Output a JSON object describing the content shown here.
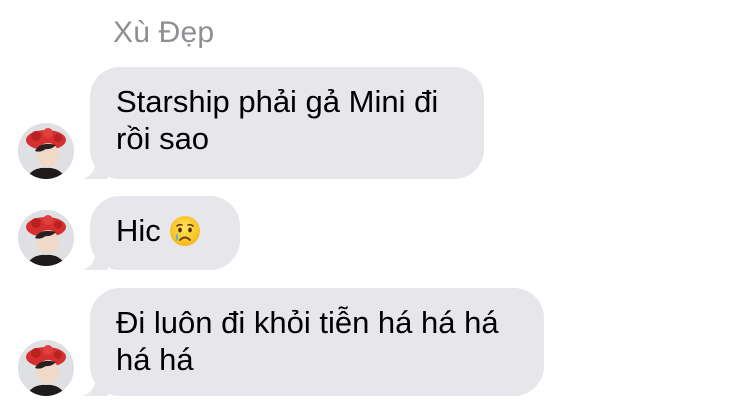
{
  "conversation": {
    "sender_name": "Xù Đẹp",
    "messages": [
      {
        "text": "Starship phải gả Mini đi\nrồi sao",
        "has_avatar": true
      },
      {
        "text": "Hic",
        "emoji": "crying-face-emoji",
        "has_avatar": true
      },
      {
        "text": "Đi luôn đi khỏi tiễn há há há\nhá há",
        "has_avatar": true
      }
    ]
  },
  "colors": {
    "bubble_gray": "#e6e6eb",
    "sender_name_gray": "#8e8e93",
    "text": "#000000",
    "avatar_accent_red": "#d5302f"
  }
}
